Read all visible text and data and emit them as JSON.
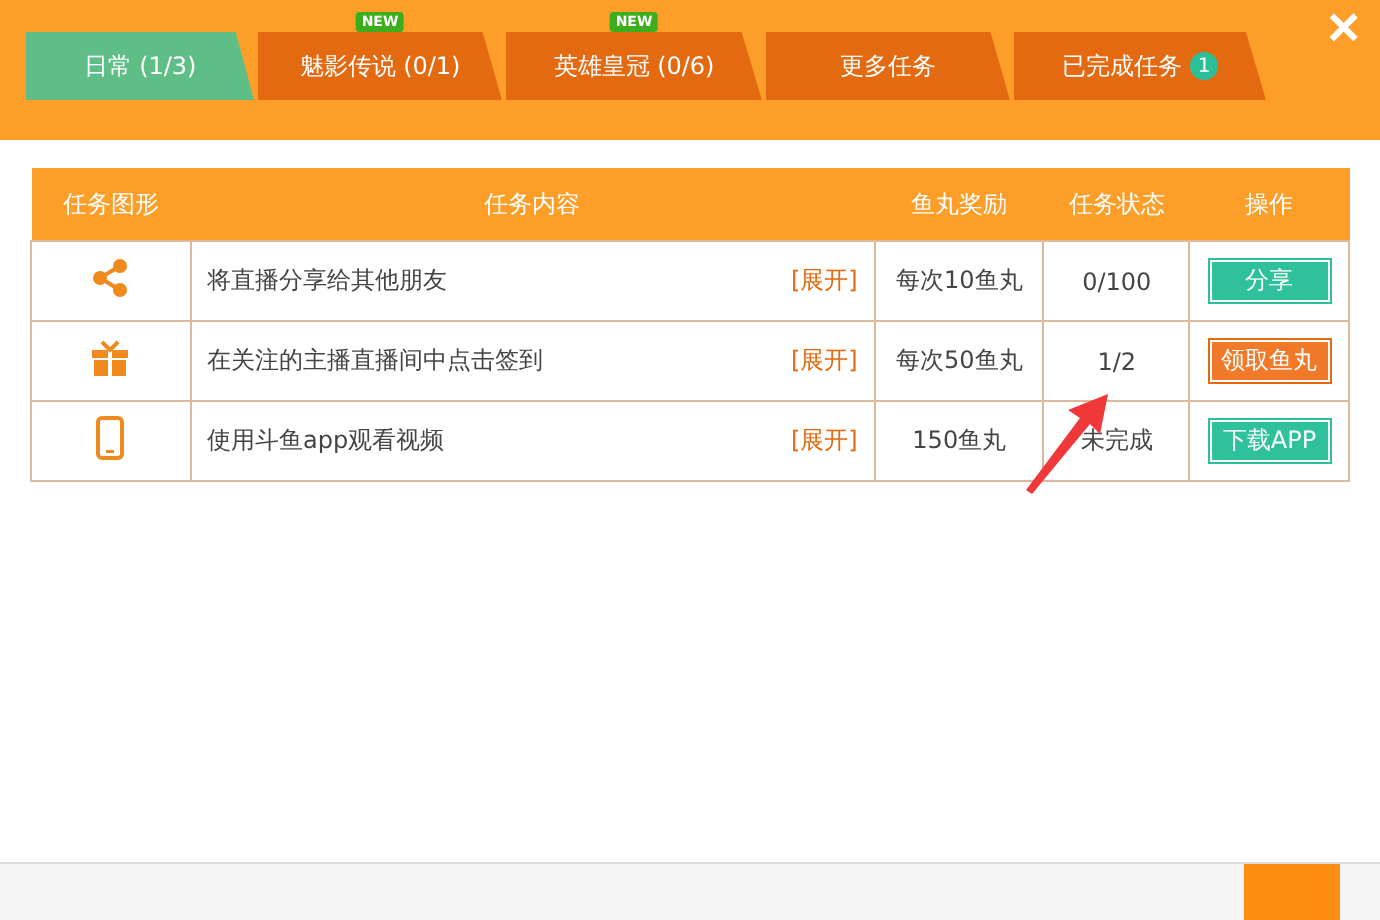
{
  "tabs": [
    {
      "label": "日常 (1/3)",
      "selected": true
    },
    {
      "label": "魅影传说 (0/1)",
      "selected": false,
      "new_badge": "NEW"
    },
    {
      "label": "英雄皇冠 (0/6)",
      "selected": false,
      "new_badge": "NEW"
    },
    {
      "label": "更多任务",
      "selected": false
    },
    {
      "label": "已完成任务",
      "selected": false,
      "count": "1"
    }
  ],
  "close": "×",
  "table": {
    "columns": [
      "任务图形",
      "任务内容",
      "鱼丸奖励",
      "任务状态",
      "操作"
    ],
    "rows": [
      {
        "kind": "share",
        "content": "将直播分享给其他朋友",
        "expand": "[展开]",
        "reward": "每次10鱼丸",
        "status": "0/100",
        "action": {
          "label": "分享",
          "kind": "green"
        }
      },
      {
        "kind": "gift",
        "content": "在关注的主播直播间中点击签到",
        "expand": "[展开]",
        "reward": "每次50鱼丸",
        "status": "1/2",
        "action": {
          "label": "领取鱼丸",
          "kind": "orange"
        }
      },
      {
        "kind": "phone",
        "content": "使用斗鱼app观看视频",
        "expand": "[展开]",
        "reward": "150鱼丸",
        "status": "未完成",
        "action": {
          "label": "下载APP",
          "kind": "green"
        }
      }
    ]
  }
}
